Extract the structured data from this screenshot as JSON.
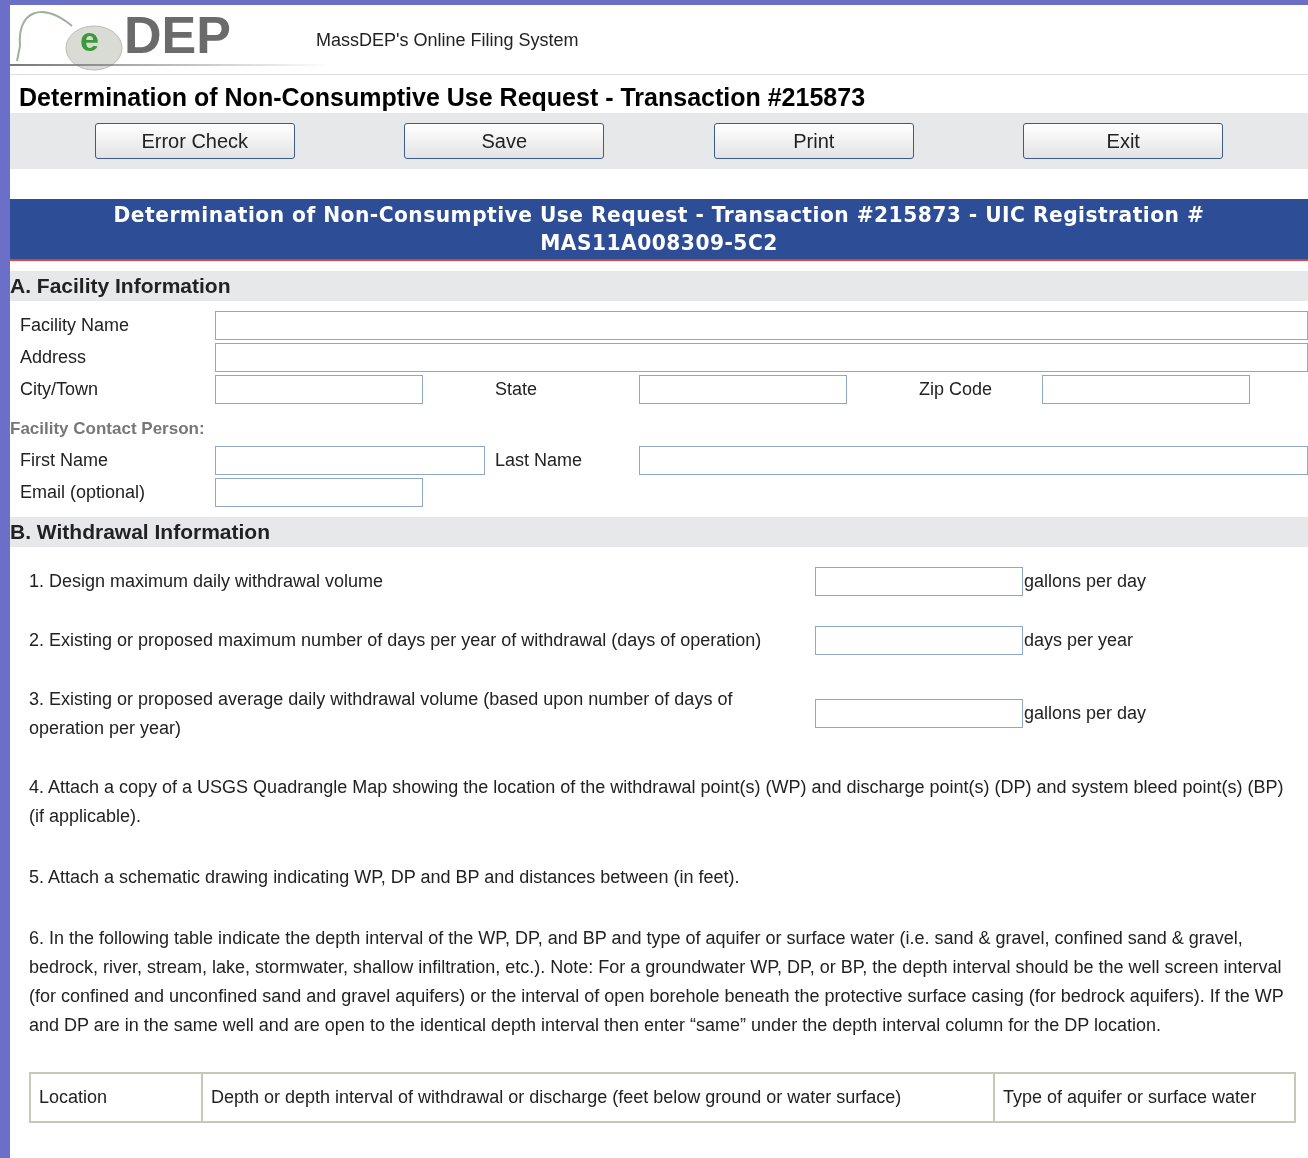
{
  "header": {
    "logo": {
      "letter": "e",
      "word": "DEP"
    },
    "tagline": "MassDEP's Online Filing System"
  },
  "page_title": "Determination of Non-Consumptive Use Request - Transaction #215873",
  "buttons": [
    "Error Check",
    "Save",
    "Print",
    "Exit"
  ],
  "banner": [
    "Determination of Non-Consumptive Use Request - Transaction #215873 - UIC Registration #",
    "MAS11A008309-5C2"
  ],
  "section_a": {
    "title": "A. Facility Information",
    "fields": [
      {
        "label": "Facility Name"
      },
      {
        "label": "Address"
      },
      {
        "label": "City/Town"
      },
      {
        "label": "State"
      },
      {
        "label": "Zip Code"
      },
      {
        "label": "First Name"
      },
      {
        "label": "Last Name"
      },
      {
        "label": "Email (optional)"
      }
    ],
    "contact_heading": "Facility Contact Person:"
  },
  "section_b": {
    "title": "B. Withdrawal Information",
    "items": [
      {
        "kind": "input",
        "text": "1. Design maximum daily withdrawal volume",
        "unit": "gallons per day"
      },
      {
        "kind": "input",
        "text": "2. Existing or proposed maximum number of days per year of withdrawal (days of operation)",
        "unit": "days per year"
      },
      {
        "kind": "input",
        "text": "3. Existing or proposed average daily withdrawal volume (based upon number of days of operation per year)",
        "unit": "gallons per day"
      },
      {
        "kind": "text",
        "text": "4. Attach a copy of a USGS Quadrangle Map showing the location of the withdrawal point(s) (WP) and discharge point(s) (DP) and system bleed point(s) (BP) (if applicable)."
      },
      {
        "kind": "text",
        "text": "5. Attach a schematic drawing indicating WP, DP and BP and distances between (in feet)."
      },
      {
        "kind": "text",
        "text": "6. In the following table indicate the depth interval of the WP, DP, and BP and type of aquifer or surface water (i.e. sand & gravel, confined sand & gravel, bedrock, river, stream, lake, stormwater, shallow infiltration, etc.). Note: For a groundwater WP, DP, or BP, the depth interval should be the well screen interval (for confined and unconfined sand and gravel aquifers) or the interval of open borehole beneath the protective surface casing (for bedrock aquifers). If the WP and DP are in the same well and are open to the identical depth interval then enter “same” under the depth interval column for the DP location."
      }
    ],
    "table": {
      "columns": [
        "Location",
        "Depth or depth interval of withdrawal or discharge (feet below ground or water surface)",
        "Type of aquifer or surface water"
      ]
    }
  }
}
